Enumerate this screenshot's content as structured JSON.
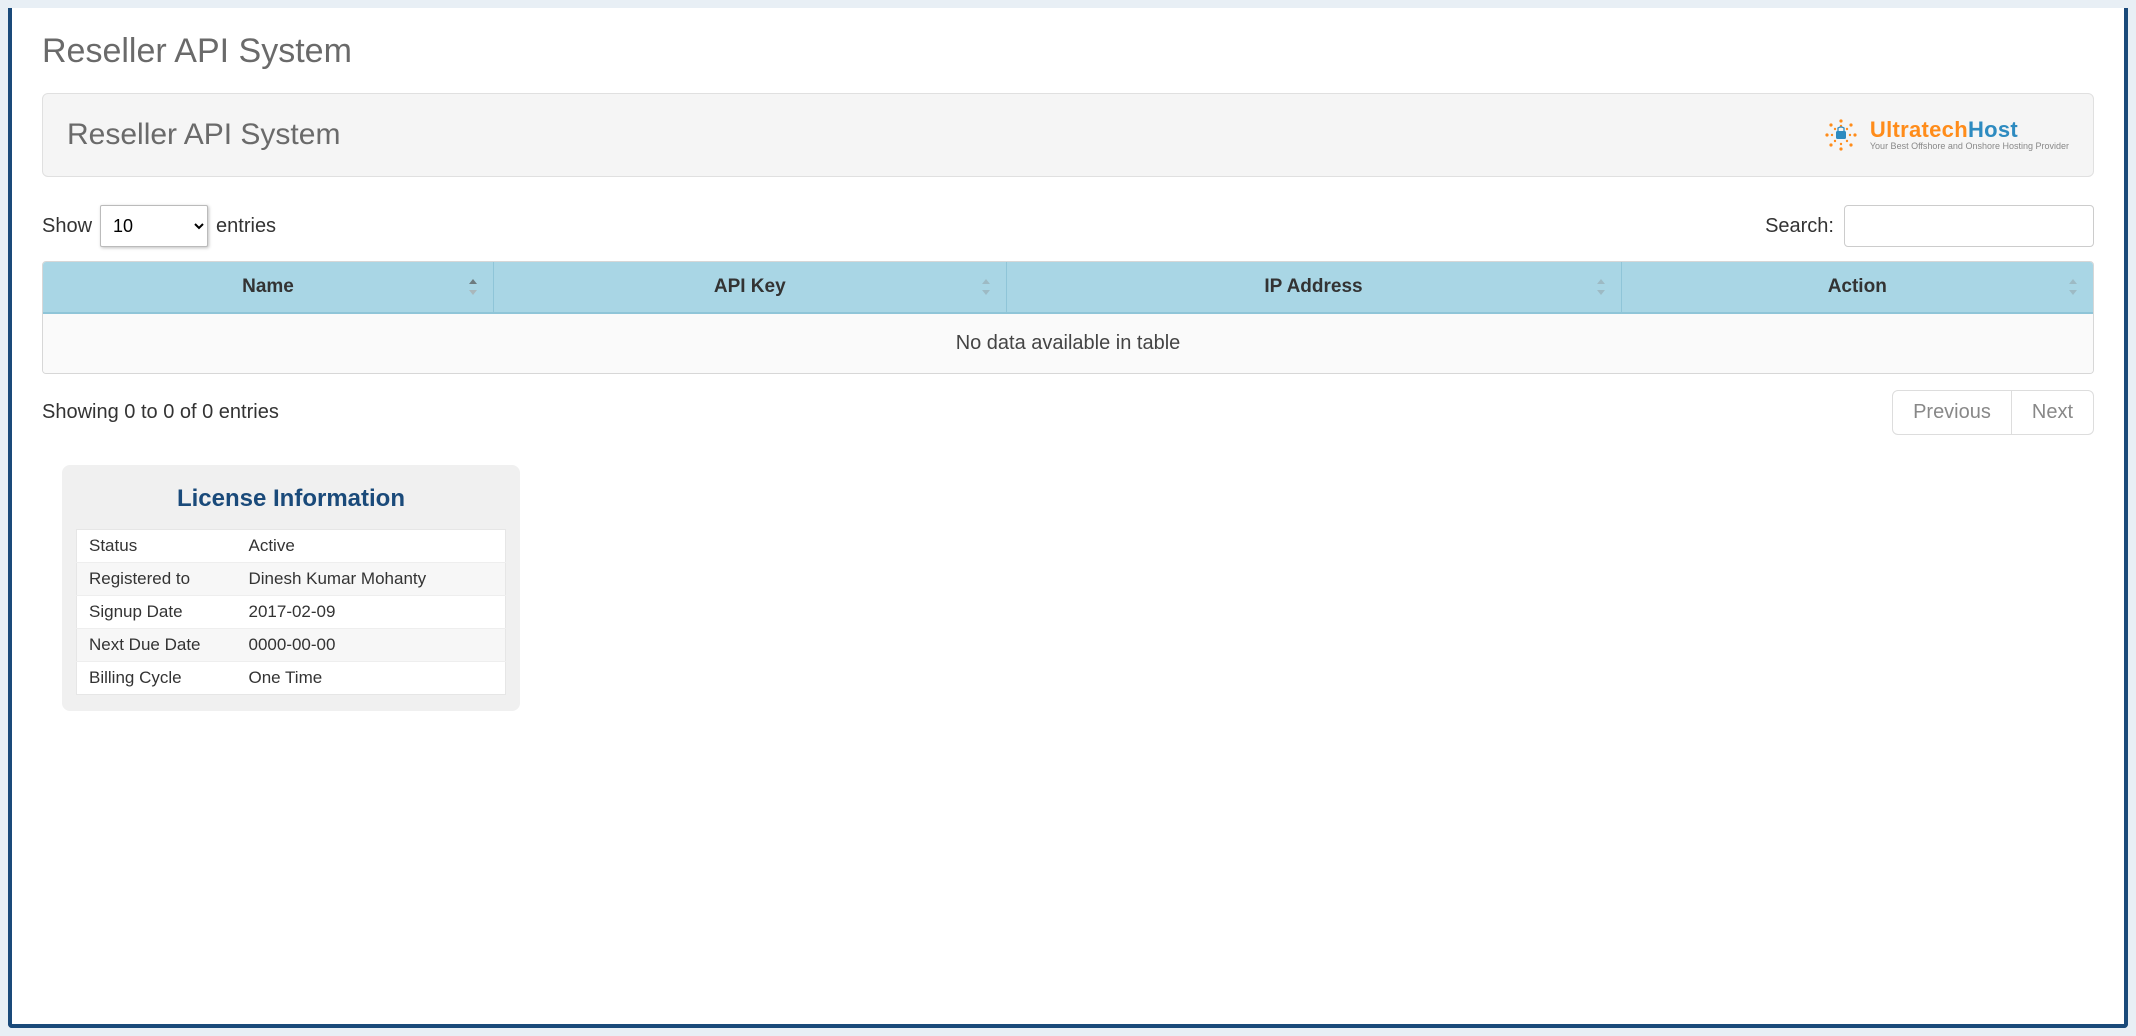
{
  "page": {
    "title": "Reseller API System"
  },
  "panel": {
    "title": "Reseller API System",
    "brand": {
      "name1": "Ultratech",
      "name2": "Host",
      "tagline": "Your Best Offshore and Onshore Hosting Provider"
    }
  },
  "length": {
    "show_label": "Show",
    "entries_label": "entries",
    "selected": "10"
  },
  "search": {
    "label": "Search:",
    "value": ""
  },
  "table": {
    "columns": {
      "name": "Name",
      "api_key": "API Key",
      "ip_address": "IP Address",
      "action": "Action"
    },
    "empty_text": "No data available in table"
  },
  "footer": {
    "info": "Showing 0 to 0 of 0 entries",
    "prev": "Previous",
    "next": "Next"
  },
  "license": {
    "title": "License Information",
    "rows": {
      "status_label": "Status",
      "status_value": "Active",
      "registered_label": "Registered to",
      "registered_value": "Dinesh Kumar Mohanty",
      "signup_label": "Signup Date",
      "signup_value": "2017-02-09",
      "due_label": "Next Due Date",
      "due_value": "0000-00-00",
      "billing_label": "Billing Cycle",
      "billing_value": "One Time"
    }
  }
}
